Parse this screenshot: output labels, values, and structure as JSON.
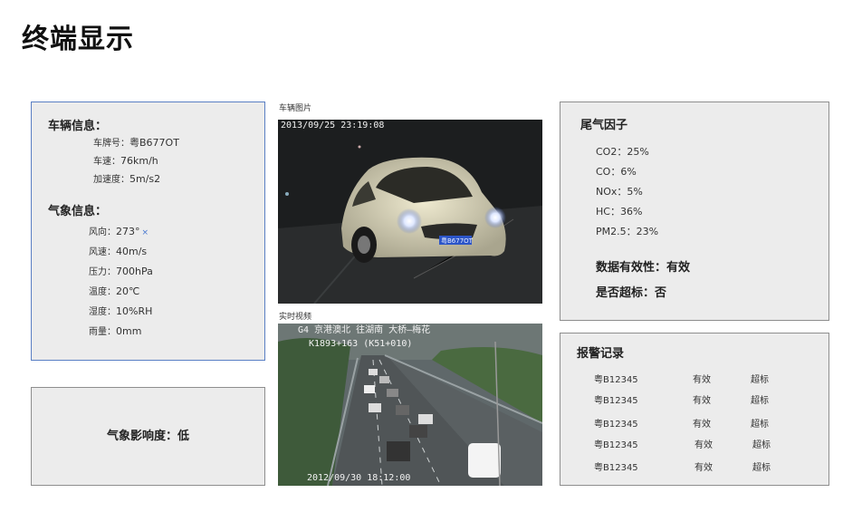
{
  "page": {
    "title": "终端显示"
  },
  "vehicle_info": {
    "heading": "车辆信息：",
    "plate_label": "车牌号：",
    "plate_value": "粤B677OT",
    "speed_label": "车速：",
    "speed_value": "76km/h",
    "accel_label": "加速度：",
    "accel_value": "5m/s2"
  },
  "weather_info": {
    "heading": "气象信息：",
    "wind_dir_label": "风向：",
    "wind_dir_value": "273°",
    "wind_speed_label": "风速：",
    "wind_speed_value": "40m/s",
    "pressure_label": "压力：",
    "pressure_value": "700hPa",
    "temp_label": "温度：",
    "temp_value": "20℃",
    "humidity_label": "湿度：",
    "humidity_value": "10%RH",
    "rain_label": "雨量：",
    "rain_value": "0mm"
  },
  "weather_impact": {
    "text": "气象影响度：低"
  },
  "vehicle_image": {
    "caption": "车辆图片",
    "timestamp": "2013/09/25 23:19:08",
    "plate_on_car": "粤B677OT"
  },
  "live_video": {
    "caption": "实时视频",
    "overlay_line1": "G4 京港澳北  往湖南    大桥—梅花",
    "overlay_line2": "K1893+163  (K51+010)",
    "timestamp": "2012/09/30 18:12:00"
  },
  "exhaust": {
    "heading": "尾气因子",
    "items": [
      {
        "label": "CO2：",
        "value": "25%"
      },
      {
        "label": "CO：",
        "value": "6%"
      },
      {
        "label": "NOx：",
        "value": "5%"
      },
      {
        "label": "HC：",
        "value": "36%"
      },
      {
        "label": "PM2.5：",
        "value": "23%"
      }
    ],
    "validity": "数据有效性：有效",
    "exceed": "是否超标：否"
  },
  "alarm": {
    "heading": "报警记录",
    "rows": [
      {
        "plate": "粤B12345",
        "status": "有效",
        "result": "超标"
      },
      {
        "plate": "粤B12345",
        "status": "有效",
        "result": "超标"
      },
      {
        "plate": "粤B12345",
        "status": "有效",
        "result": "超标"
      },
      {
        "plate": "粤B12345",
        "status": "有效",
        "result": "超标"
      },
      {
        "plate": "粤B12345",
        "status": "有效",
        "result": "超标"
      }
    ]
  }
}
